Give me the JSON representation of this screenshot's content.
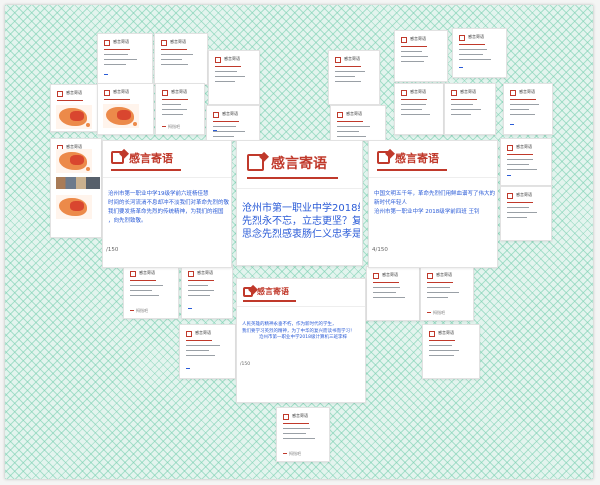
{
  "board": {
    "featured": [
      {
        "title": "感言寄语",
        "lines": [
          "沧州市第一职业中学19级学前六班杨佳慧",
          "时间的长河流淌不息却冲不淡我们对革命先烈的敬",
          "我们要发扬革命先烈的传统精神，为我们的祖国",
          "，向先烈致敬。"
        ],
        "count": "/150"
      },
      {
        "title": "感言寄语",
        "lines": [
          "沧州市第一职业中学2018级对口",
          "先烈永不忘，立志更坚？复兴中",
          "思念先烈感衷肠仁义忠孝是祖国"
        ],
        "count": ""
      },
      {
        "title": "感言寄语",
        "lines": [
          "中国文明五千年，革命先烈们用鲜血谱写了伟大的",
          "新时代年轻人",
          "沧州市第一职业中学 2018级学前四班 王钊"
        ],
        "count": "4/150"
      },
      {
        "title": "感言寄语",
        "lines": [
          "人民英雄的精神永垂不朽，作为新时代的学生，",
          "我们要学习英烈的精神，为了中华的复兴而读书而学习！",
          "沧州市第一职业中学2018级计算机三班李梓"
        ],
        "count": "/150"
      }
    ],
    "small_title": "感言寄语",
    "footer_label": "拇指吧"
  }
}
